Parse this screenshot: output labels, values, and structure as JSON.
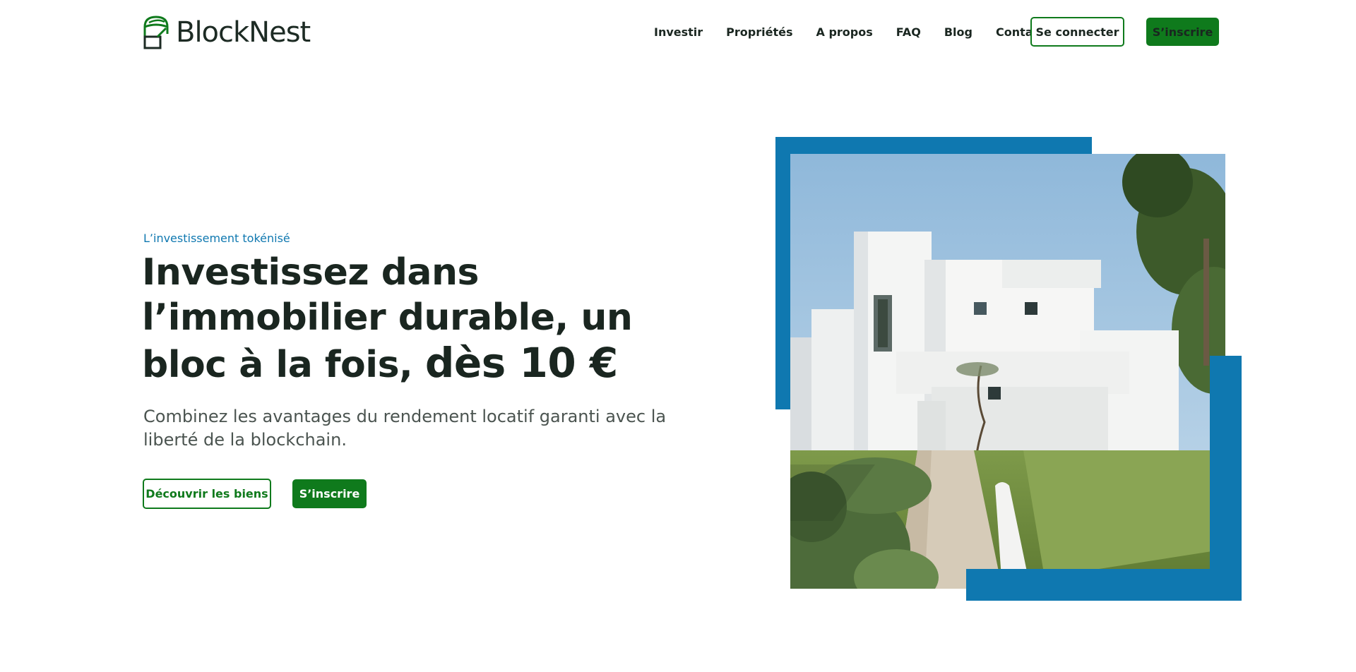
{
  "brand": {
    "name": "BlockNest"
  },
  "nav": {
    "items": [
      {
        "label": "Investir",
        "name": "nav-investir"
      },
      {
        "label": "Propriétés",
        "name": "nav-proprietes"
      },
      {
        "label": "A propos",
        "name": "nav-a-propos"
      },
      {
        "label": "FAQ",
        "name": "nav-faq"
      },
      {
        "label": "Blog",
        "name": "nav-blog"
      },
      {
        "label": "Contact",
        "name": "nav-contact"
      }
    ],
    "login_label": "Se connecter",
    "signup_label": "S’inscrire"
  },
  "hero": {
    "eyebrow": "L’investissement tokénisé",
    "title_main": "Investissez dans l’immobilier durable, un bloc à la fois, ",
    "title_accent": "dès 10 €",
    "subtitle": "Combinez les avantages du rendement locatif garanti avec la liberté de la blockchain.",
    "discover_label": "Découvrir les biens",
    "signup_label": "S’inscrire"
  },
  "colors": {
    "brand_green": "#0f7a1c",
    "accent_blue": "#0f78b0",
    "text_dark": "#1a2620",
    "text_muted": "#4b5450"
  },
  "image": {
    "subject": "white-modern-house"
  }
}
